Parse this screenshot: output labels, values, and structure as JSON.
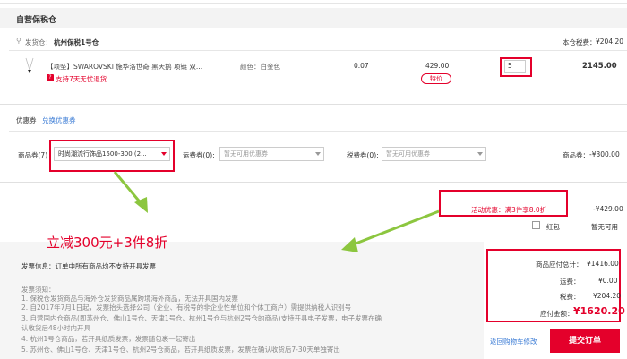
{
  "store": {
    "title": "自营保税仓"
  },
  "warehouse": {
    "label": "发货仓：",
    "name": "杭州保税1号仓",
    "tax_label": "本仓税费：",
    "tax_value": "¥204.20"
  },
  "product": {
    "name": "【项坠】SWAROVSKI 施华洛世奇 黑天鹅 项链 双...",
    "return_text": "支持7天无忧退货",
    "attr": "颜色：白金色",
    "tax_rate": "0.07",
    "price": "429.00",
    "promo_tag": "特价",
    "quantity": "5",
    "subtotal": "2145.00"
  },
  "coupons": {
    "section_label": "优惠券",
    "exchange_link": "兑换优惠券",
    "goods_label": "商品券(7)",
    "goods_selected": "时尚潮流行饰品1500-300 (2...",
    "freight_label": "运费券(0):",
    "freight_placeholder": "暂无可用优惠券",
    "tax_label": "税费券(0):",
    "tax_placeholder": "暂无可用优惠券",
    "goods_discount_label": "商品券：",
    "goods_discount_value": "-¥300.00"
  },
  "activity": {
    "text": "活动优惠：满3件享8.0折",
    "value": "-¥429.00",
    "red_packet_label": "红包",
    "red_packet_value": "暂无可用"
  },
  "annotation": {
    "text": "立减300元+3件8折"
  },
  "invoice": {
    "info": "发票信息：订单中所有商品均不支持开具发票",
    "notes_title": "发票须知：",
    "notes": [
      "1. 保税仓发货商品与海外仓发货商品属跨境海外商品，无法开具国内发票",
      "2. 自2017年7月1日起，发票抬头选择公司（企业、有税号的非企业性单位和个体工商户）需提供纳税人识别号",
      "3. 自营国内仓商品(即苏州仓、佛山1号仓、天津1号仓、杭州1号仓与杭州2号仓的商品)支持开具电子发票，电子发票在确",
      "认收货后48小时内开具",
      "4. 杭州1号仓商品，若开具纸质发票，发票随包裹一起寄出",
      "5. 苏州仓、佛山1号仓、天津1号仓、杭州2号仓商品，若开具纸质发票，发票在确认收货后7-30天单独寄出"
    ]
  },
  "summary": {
    "goods_total_label": "商品应付总计：",
    "goods_total_value": "¥1416.00",
    "freight_label": "运费：",
    "freight_value": "¥0.00",
    "tax_label": "税费：",
    "tax_value": "¥204.20",
    "pay_label": "应付金额：",
    "pay_value": "¥1620.20",
    "back_link": "返回购物车修改",
    "submit_label": "提交订单"
  },
  "colors": {
    "accent": "#e4002b",
    "arrow": "#8cc63f",
    "link": "#3a7bd5"
  }
}
